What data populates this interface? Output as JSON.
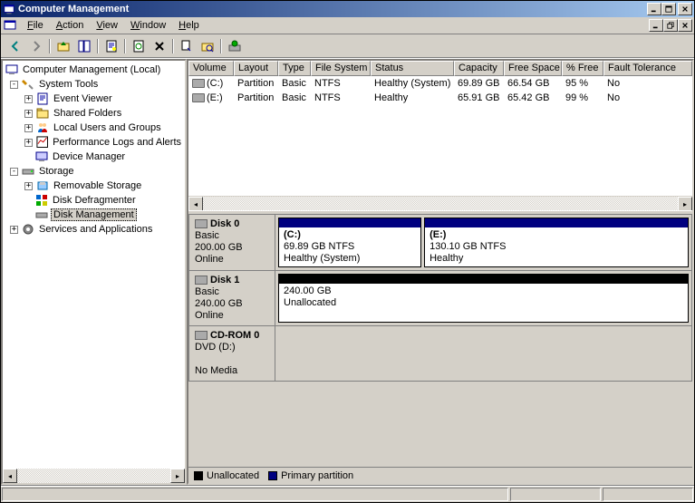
{
  "window": {
    "title": "Computer Management"
  },
  "menu": {
    "file": "File",
    "action": "Action",
    "view": "View",
    "window": "Window",
    "help": "Help"
  },
  "tree": {
    "root": "Computer Management (Local)",
    "system_tools": "System Tools",
    "event_viewer": "Event Viewer",
    "shared_folders": "Shared Folders",
    "local_users": "Local Users and Groups",
    "perf_logs": "Performance Logs and Alerts",
    "device_manager": "Device Manager",
    "storage": "Storage",
    "removable": "Removable Storage",
    "defrag": "Disk Defragmenter",
    "disk_mgmt": "Disk Management",
    "services": "Services and Applications"
  },
  "vol_headers": {
    "volume": "Volume",
    "layout": "Layout",
    "type": "Type",
    "fs": "File System",
    "status": "Status",
    "capacity": "Capacity",
    "free": "Free Space",
    "pct": "% Free",
    "fault": "Fault Tolerance"
  },
  "volumes": [
    {
      "name": "(C:)",
      "layout": "Partition",
      "type": "Basic",
      "fs": "NTFS",
      "status": "Healthy (System)",
      "capacity": "69.89 GB",
      "free": "66.54 GB",
      "pct": "95 %",
      "fault": "No"
    },
    {
      "name": "(E:)",
      "layout": "Partition",
      "type": "Basic",
      "fs": "NTFS",
      "status": "Healthy",
      "capacity": "65.91 GB",
      "free": "65.42 GB",
      "pct": "99 %",
      "fault": "No"
    }
  ],
  "disks": [
    {
      "title": "Disk 0",
      "type": "Basic",
      "size": "200.00 GB",
      "state": "Online",
      "parts": [
        {
          "label": "(C:)",
          "size": "69.89 GB NTFS",
          "status": "Healthy (System)",
          "color": "#000080",
          "flex": 35
        },
        {
          "label": "(E:)",
          "size": "130.10 GB NTFS",
          "status": "Healthy",
          "color": "#000080",
          "flex": 65
        }
      ]
    },
    {
      "title": "Disk 1",
      "type": "Basic",
      "size": "240.00 GB",
      "state": "Online",
      "parts": [
        {
          "label": "",
          "size": "240.00 GB",
          "status": "Unallocated",
          "color": "#000000",
          "flex": 100
        }
      ]
    },
    {
      "title": "CD-ROM 0",
      "type": "DVD (D:)",
      "size": "",
      "state": "No Media",
      "parts": []
    }
  ],
  "legend": {
    "unalloc": "Unallocated",
    "primary": "Primary partition"
  },
  "colors": {
    "unalloc": "#000000",
    "primary": "#000080"
  }
}
